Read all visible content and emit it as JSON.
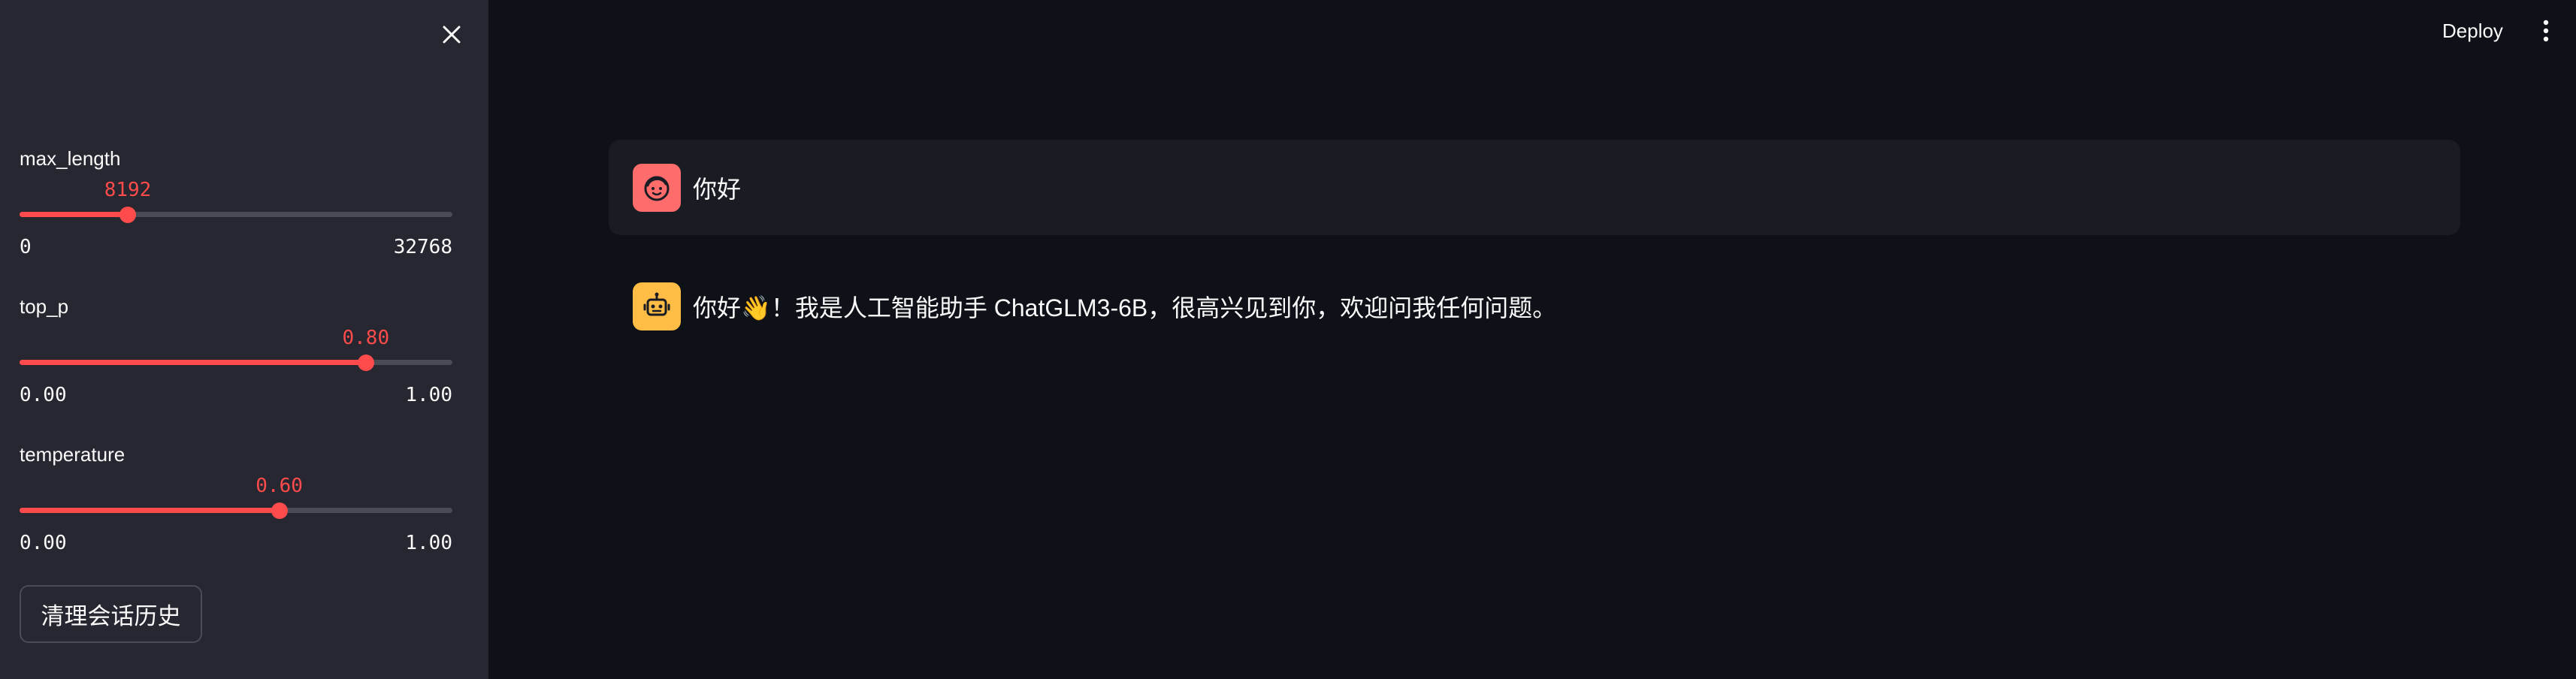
{
  "sidebar": {
    "sliders": [
      {
        "label": "max_length",
        "value": "8192",
        "min": "0",
        "max": "32768",
        "fraction": 0.25
      },
      {
        "label": "top_p",
        "value": "0.80",
        "min": "0.00",
        "max": "1.00",
        "fraction": 0.8
      },
      {
        "label": "temperature",
        "value": "0.60",
        "min": "0.00",
        "max": "1.00",
        "fraction": 0.6
      }
    ],
    "clear_button_label": "清理会话历史",
    "close_icon": "close-icon"
  },
  "header": {
    "deploy_label": "Deploy",
    "menu_icon": "kebab-menu-icon"
  },
  "chat": {
    "messages": [
      {
        "role": "user",
        "avatar_icon": "user-face-icon",
        "text": "你好"
      },
      {
        "role": "assistant",
        "avatar_icon": "robot-icon",
        "text": "你好👋！我是人工智能助手 ChatGLM3-6B，很高兴见到你，欢迎问我任何问题。"
      }
    ]
  },
  "colors": {
    "accent": "#ff4b4b",
    "sidebar_bg": "#262730",
    "main_bg": "#0e1117",
    "user_msg_bg": "#1a1c24",
    "user_avatar": "#ff6c6c",
    "bot_avatar": "#ffbd45"
  }
}
